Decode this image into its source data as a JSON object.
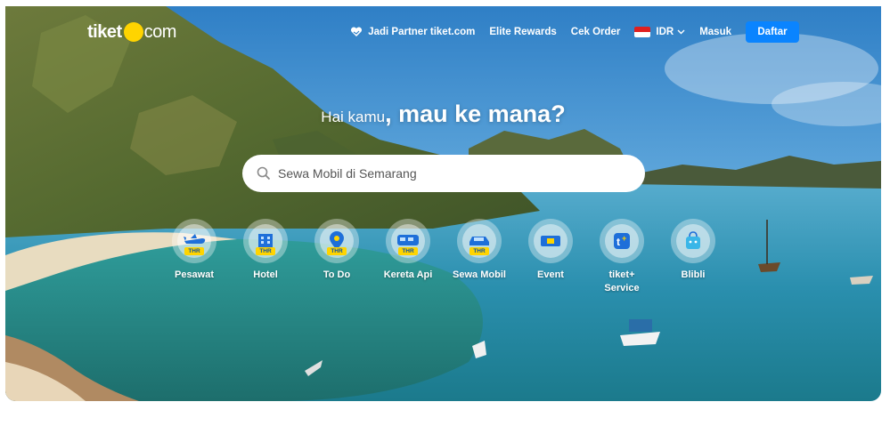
{
  "brand": {
    "logo_left": "tiket",
    "logo_right": "com"
  },
  "nav": {
    "partner": "Jadi Partner tiket.com",
    "rewards": "Elite Rewards",
    "order": "Cek Order",
    "currency": "IDR",
    "login": "Masuk",
    "register": "Daftar"
  },
  "hero": {
    "greeting": "Hai kamu",
    "question": ", mau ke mana?"
  },
  "search": {
    "placeholder": "Sewa Mobil di Semarang"
  },
  "categories": [
    {
      "label": "Pesawat",
      "icon": "plane-icon",
      "badge": "THR"
    },
    {
      "label": "Hotel",
      "icon": "hotel-icon",
      "badge": "THR"
    },
    {
      "label": "To Do",
      "icon": "pin-icon",
      "badge": "THR"
    },
    {
      "label": "Kereta Api",
      "icon": "train-icon",
      "badge": "THR"
    },
    {
      "label": "Sewa Mobil",
      "icon": "car-icon",
      "badge": "THR"
    },
    {
      "label": "Event",
      "icon": "ticket-icon"
    },
    {
      "label": "tiket+",
      "label2": "Service",
      "icon": "tiket-plus-icon"
    },
    {
      "label": "Blibli",
      "icon": "blibli-bag-icon"
    }
  ],
  "colors": {
    "primary": "#0a84ff",
    "logo_yellow": "#ffd400",
    "sea": "#1f8fa6"
  }
}
